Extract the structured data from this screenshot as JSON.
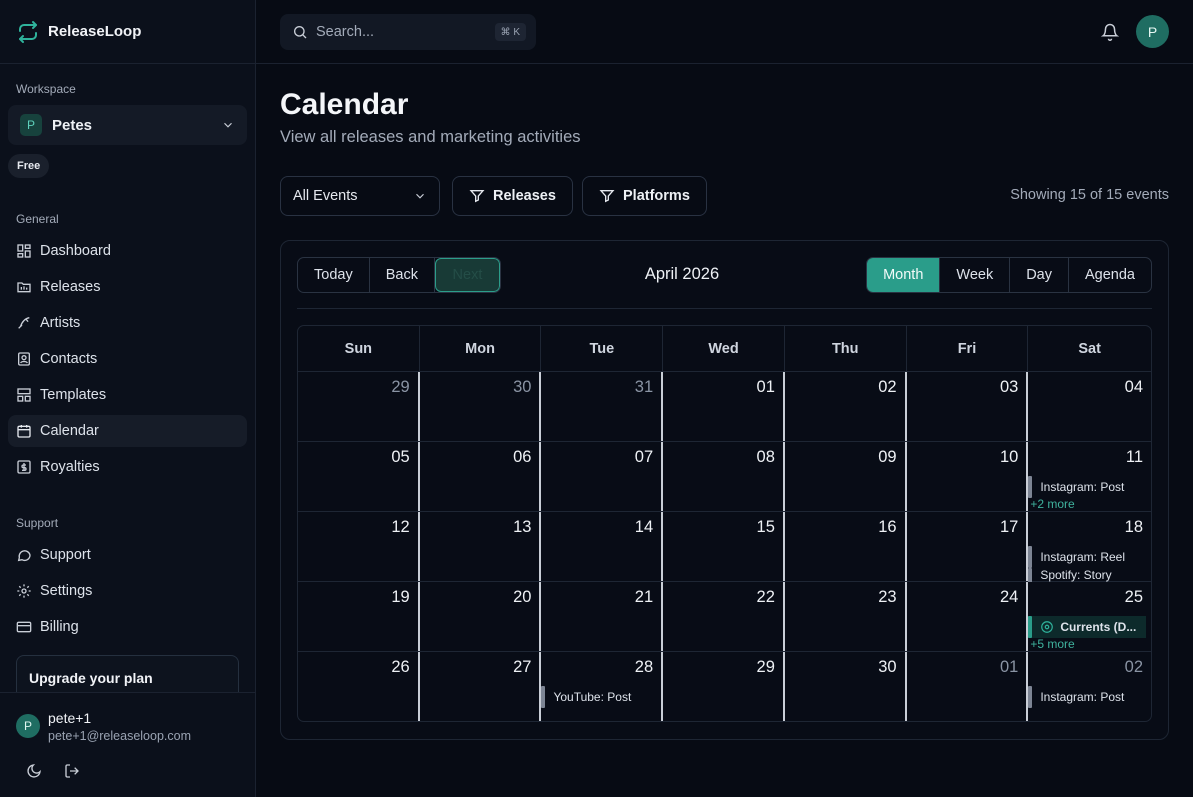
{
  "brand": {
    "name": "ReleaseLoop"
  },
  "sidebar": {
    "workspace_label": "Workspace",
    "workspace": {
      "initial": "P",
      "name": "Petes"
    },
    "plan": "Free",
    "general_label": "General",
    "general_items": [
      {
        "label": "Dashboard",
        "icon": "dashboard-icon"
      },
      {
        "label": "Releases",
        "icon": "folder-icon"
      },
      {
        "label": "Artists",
        "icon": "pen-icon"
      },
      {
        "label": "Contacts",
        "icon": "contact-icon"
      },
      {
        "label": "Templates",
        "icon": "layout-icon"
      },
      {
        "label": "Calendar",
        "icon": "calendar-icon",
        "active": true
      },
      {
        "label": "Royalties",
        "icon": "dollar-icon"
      }
    ],
    "support_label": "Support",
    "support_items": [
      {
        "label": "Support",
        "icon": "chat-icon"
      },
      {
        "label": "Settings",
        "icon": "gear-icon"
      },
      {
        "label": "Billing",
        "icon": "card-icon"
      }
    ],
    "upgrade": "Upgrade your plan",
    "user": {
      "initial": "P",
      "name": "pete+1",
      "email": "pete+1@releaseloop.com"
    }
  },
  "topbar": {
    "search_placeholder": "Search...",
    "shortcut": "⌘ K",
    "avatar_initial": "P"
  },
  "page": {
    "title": "Calendar",
    "subtitle": "View all releases and marketing activities",
    "filter_select": "All Events",
    "filter_releases": "Releases",
    "filter_platforms": "Platforms",
    "showing": "Showing 15 of 15 events"
  },
  "calendar": {
    "nav": {
      "today": "Today",
      "back": "Back",
      "next": "Next"
    },
    "title": "April 2026",
    "views": [
      "Month",
      "Week",
      "Day",
      "Agenda"
    ],
    "active_view": "Month",
    "weekdays": [
      "Sun",
      "Mon",
      "Tue",
      "Wed",
      "Thu",
      "Fri",
      "Sat"
    ],
    "weeks": [
      [
        {
          "d": "29",
          "off": true
        },
        {
          "d": "30",
          "off": true
        },
        {
          "d": "31",
          "off": true
        },
        {
          "d": "01"
        },
        {
          "d": "02"
        },
        {
          "d": "03"
        },
        {
          "d": "04"
        }
      ],
      [
        {
          "d": "05"
        },
        {
          "d": "06"
        },
        {
          "d": "07"
        },
        {
          "d": "08"
        },
        {
          "d": "09"
        },
        {
          "d": "10"
        },
        {
          "d": "11",
          "events": [
            "Instagram: Post"
          ],
          "more": "+2 more"
        }
      ],
      [
        {
          "d": "12"
        },
        {
          "d": "13"
        },
        {
          "d": "14"
        },
        {
          "d": "15"
        },
        {
          "d": "16"
        },
        {
          "d": "17"
        },
        {
          "d": "18",
          "events": [
            "Instagram: Reel",
            "Spotify: Story"
          ]
        }
      ],
      [
        {
          "d": "19"
        },
        {
          "d": "20"
        },
        {
          "d": "21"
        },
        {
          "d": "22"
        },
        {
          "d": "23"
        },
        {
          "d": "24"
        },
        {
          "d": "25",
          "release": "Currents (D...",
          "more": "+5 more"
        }
      ],
      [
        {
          "d": "26"
        },
        {
          "d": "27"
        },
        {
          "d": "28",
          "events": [
            "YouTube: Post"
          ]
        },
        {
          "d": "29"
        },
        {
          "d": "30"
        },
        {
          "d": "01",
          "off": true
        },
        {
          "d": "02",
          "off": true,
          "events": [
            "Instagram: Post"
          ]
        }
      ]
    ]
  },
  "colors": {
    "accent": "#2a9d8a",
    "background": "#070b14",
    "sidebar": "#0b101b"
  }
}
